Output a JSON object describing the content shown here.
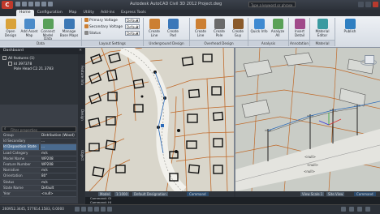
{
  "titlebar": {
    "app_button": "C",
    "title": "Autodesk AutoCAD Civil 3D 2012  Project.dwg",
    "search_placeholder": "Type a keyword or phrase"
  },
  "tabs": [
    "Home",
    "Configuration",
    "Map",
    "Utility",
    "Add-ins",
    "Express Tools"
  ],
  "ribbon": {
    "buttons": [
      {
        "label": "Open Design",
        "color": "#d9a23a"
      },
      {
        "label": "Add Asset Map",
        "color": "#4b8bc9"
      },
      {
        "label": "Connect Model Data",
        "color": "#58a05a"
      },
      {
        "label": "Manage Base Maps",
        "color": "#3c78b5"
      }
    ],
    "layout": {
      "primary_voltage_label": "Primary Voltage",
      "secondary_voltage_label": "Secondary Voltage",
      "status_label": "Status",
      "default_value": "Default"
    },
    "create_buttons": [
      {
        "label": "Create Line",
        "color": "#cc7f32"
      },
      {
        "label": "Create Pad",
        "color": "#3a77b9"
      },
      {
        "label": "Create Line",
        "color": "#cc7f32"
      },
      {
        "label": "Create Pole",
        "color": "#6a6a6a"
      },
      {
        "label": "Create Guy",
        "color": "#8a5a2a"
      },
      {
        "label": "Quick Info",
        "color": "#3f8ad1"
      },
      {
        "label": "Analyze All",
        "color": "#5aa157"
      },
      {
        "label": "Insert Detail",
        "color": "#a04a8a"
      },
      {
        "label": "Material Editor",
        "color": "#3a9aa0"
      },
      {
        "label": "Publish",
        "color": "#2f7fc1"
      }
    ],
    "groups": [
      "Data",
      "Layout Settings",
      "Underground Design",
      "Overhead Design",
      "Analysis",
      "Annotation",
      "Material"
    ]
  },
  "toolspace": {
    "title": "Dashboard",
    "tree": [
      "All features (1)",
      "Id 397378",
      "Pole Head C2.21.3783"
    ],
    "vtabs": [
      "Feature Info",
      "Design",
      "Object"
    ],
    "filter_placeholder": "Filter properties",
    "properties": [
      {
        "k": "Group",
        "v": "Distribution (Wood)"
      },
      {
        "k": "Id Secondary",
        "v": "..."
      },
      {
        "k": "Id Disposition State",
        "v": "..."
      },
      {
        "k": "Load Category",
        "v": "m/s"
      },
      {
        "k": "Model Name",
        "v": "WP208"
      },
      {
        "k": "Feature Number",
        "v": "WP208"
      },
      {
        "k": "Narrative",
        "v": "m/s"
      },
      {
        "k": "Orientation",
        "v": "80°"
      },
      {
        "k": "Status",
        "v": "m/s"
      },
      {
        "k": "State Name",
        "v": "Default"
      },
      {
        "k": "Year",
        "v": "<null>"
      }
    ]
  },
  "viewports": {
    "scale_label": "Fence 1",
    "dim_labels": [
      "<null>",
      "<null>",
      "<null>"
    ]
  },
  "layout_bar_left": [
    "Model",
    "1:1000",
    "Default Designation"
  ],
  "layout_bar_left_cmd": "Command",
  "layout_bar_right": [
    "View Scale 1",
    "Site View"
  ],
  "layout_bar_right_cmd": "Command",
  "command_lines": [
    "Command: GI",
    "Command: HI"
  ],
  "status": {
    "coords": "260952.3445, 577614.1583, 0.0000"
  }
}
